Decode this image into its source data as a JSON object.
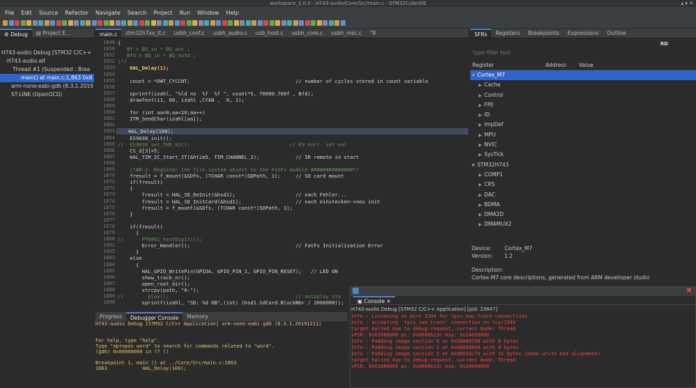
{
  "window": {
    "title": "workspace_1.0.0 - H743-audio/Core/Src/main.c - STM32CubeIDE"
  },
  "menu": [
    "File",
    "Edit",
    "Source",
    "Refactor",
    "Navigate",
    "Search",
    "Project",
    "Run",
    "Window",
    "Help"
  ],
  "left_tabs": [
    "Debug",
    "Project E..."
  ],
  "debug_tree": [
    "H743-audio Debug [STM32 C/C++",
    "H743-audio.elf",
    "Thread #1 (Suspended : Brea",
    "main() at main.c:1,863 0x8",
    "arm-none-eabi-gdb (8.3.1.2019",
    "ST-LINK (OpenOCD)"
  ],
  "editor_tabs": [
    "main.c",
    "stm32h7xx_it.c",
    "usbh_conf.c",
    "usbh_audio.c",
    "usb_host.c",
    "usbh_core.c",
    "usbh_msc.c",
    "\"8"
  ],
  "code": [
    {
      "n": "1849",
      "t": "{"
    },
    {
      "n": "1850",
      "t": "   Bf = BQ_in * BQ_out ;",
      "c": "cm"
    },
    {
      "n": "1851",
      "t": "   Bfd = BQ_in * BQ_outd ;",
      "c": "cm"
    },
    {
      "n": "1852",
      "t": "}*/",
      "c": "cm"
    },
    {
      "n": "1853",
      "t": "    HAL_Delay(1);",
      "c": "fn"
    },
    {
      "n": "1854",
      "t": ""
    },
    {
      "n": "1855",
      "t": "    count = *DWT_CYCCNT;                                   // number of cycles stored in count variable"
    },
    {
      "n": "1856",
      "t": ""
    },
    {
      "n": "1857",
      "t": "    sprintf(izahl, \"%ld ns  %f  %f \", count*5, 70000.700f , Bfd);"
    },
    {
      "n": "1858",
      "t": "    drawText(11, 60, izahl ,CYAN ,  0, 1);"
    },
    {
      "n": "1859",
      "t": ""
    },
    {
      "n": "1860",
      "t": "    for (int aa=0;aa<10;aa++)"
    },
    {
      "n": "1861",
      "t": "    ITM_SendChar(izahl[aa]);"
    },
    {
      "n": "1862",
      "t": ""
    },
    {
      "n": "1863",
      "t": "    HAL_Delay(100);",
      "hl": true
    },
    {
      "n": "1864",
      "t": "    ES9038_init();"
    },
    {
      "n": "1865",
      "t": "//  ES9038_set_THD_K3();                                 // K3 korr. set val",
      "c": "cm"
    },
    {
      "n": "1866",
      "t": "    CS_d[3]=5;"
    },
    {
      "n": "1867",
      "t": "    HAL_TIM_IC_Start_IT(&htim5, TIM_CHANNEL_2);            // IR remote in start"
    },
    {
      "n": "1868",
      "t": ""
    },
    {
      "n": "1869",
      "t": "    /*##-2- Register the file system object to the FatFs module ##############*/",
      "c": "cm"
    },
    {
      "n": "1870",
      "t": "    fresult = f_mount(&SDfs, (TCHAR const*)SDPath, 1);     // SD card mount"
    },
    {
      "n": "1871",
      "t": "    if(fresult)"
    },
    {
      "n": "1872",
      "t": "    {"
    },
    {
      "n": "1873",
      "t": "        fresult = HAL_SD_DeInit(&hsd1);                    // nach Fehler..."
    },
    {
      "n": "1874",
      "t": "        fresult = HAL_SD_InitCard(&hsd1);                  // nach einstecken->neu init"
    },
    {
      "n": "1875",
      "t": "        fresult = f_mount(&SDfs, (TCHAR const*)SDPath, 1);"
    },
    {
      "n": "1876",
      "t": "    }"
    },
    {
      "n": "1877",
      "t": ""
    },
    {
      "n": "1878",
      "t": "    if(fresult)"
    },
    {
      "n": "1879",
      "t": "      {"
    },
    {
      "n": "1880",
      "t": "//      PT6961_testDigits();",
      "c": "cm"
    },
    {
      "n": "1881",
      "t": "        Error_Handler();                                   // FatFs Initialization Error"
    },
    {
      "n": "1882",
      "t": "      }"
    },
    {
      "n": "1883",
      "t": "    else"
    },
    {
      "n": "1884",
      "t": "      {"
    },
    {
      "n": "1885",
      "t": "        HAL_GPIO_WritePin(GPIOA, GPIO_PIN_1, GPIO_PIN_RESET);   // LED ON"
    },
    {
      "n": "1886",
      "t": "        show_track_nr();"
    },
    {
      "n": "1887",
      "t": "        open_root_dir();"
    },
    {
      "n": "1888",
      "t": "        strcpy(path, \"0:\");"
    },
    {
      "n": "1889",
      "t": "//        play();                                          // autoplay sta",
      "c": "cm"
    },
    {
      "n": "1890",
      "t": "        sprintf(izahl, \"SD: %d GB\",(int) (hsd1.SdCard.BlockNbr / 2000000));"
    }
  ],
  "right_tabs": [
    "SFRs",
    "Registers",
    "Breakpoints",
    "Expressions",
    "Outline"
  ],
  "sfr": {
    "filter_placeholder": "type filter text",
    "rd_label": "RD",
    "col_register": "Register",
    "col_address": "Address",
    "col_value": "Value",
    "tree": [
      {
        "l": "Cortex_M7",
        "lvl": 0,
        "open": true,
        "sel": true
      },
      {
        "l": "Cache",
        "lvl": 1
      },
      {
        "l": "Control",
        "lvl": 1
      },
      {
        "l": "FPE",
        "lvl": 1
      },
      {
        "l": "ID",
        "lvl": 1
      },
      {
        "l": "ImpDef",
        "lvl": 1
      },
      {
        "l": "MPU",
        "lvl": 1
      },
      {
        "l": "NVIC",
        "lvl": 1
      },
      {
        "l": "SysTick",
        "lvl": 1
      },
      {
        "l": "STM32H743",
        "lvl": 0,
        "open": true
      },
      {
        "l": "COMP1",
        "lvl": 1
      },
      {
        "l": "CRS",
        "lvl": 1
      },
      {
        "l": "DAC",
        "lvl": 1
      },
      {
        "l": "BDMA",
        "lvl": 1
      },
      {
        "l": "DMA2D",
        "lvl": 1
      },
      {
        "l": "DMAMUX2",
        "lvl": 1
      }
    ],
    "device_label": "Device:",
    "device_value": "Cortex_M7",
    "version_label": "Version:",
    "version_value": "1.2",
    "description_label": "Description:",
    "description_value": "Cortex-M7 core descriptions, generated from ARM develloper studio"
  },
  "bottom_tabs": [
    "Progress",
    "Debugger Console",
    "Memory"
  ],
  "console1": "H743-audio Debug [STM32 C/C++ Application] arm-none-eabi-gdb (8.3.1.20191211)\n\n\nFor help, type \"help\".\nType \"apropos word\" to search for commands related to \"word\".\n(gdb) 0x00000000 in ?? ()\n\nBreakpoint 1, main () at ../Core/Src/main.c:1863\n1863            HAL_Delay(100);",
  "console2": {
    "tab": "Console",
    "header": "H743-audio Debug [STM32 C/C++ Application] [pid: 23647]",
    "lines": [
      "Info : Listening on port 3344 for tpiu_swo_trace connections",
      "Info : accepting 'tpiu_swo_trace' connection on tcp/3344",
      "target halted due to debug-request, current mode: Thread",
      "xPSR: 0x01000000 pc: 0x0800b23c msp: 0x24080000",
      "Info : Padding image section 0 at 0x08000298 with 8 bytes",
      "Info : Padding image section 1 at 0x08020644 with 4 bytes",
      "Info : Padding image section 2 at 0x08024cf4 with 12 bytes (bank write end alignment)",
      "target halted due to debug-request, current mode: Thread",
      "xPSR: 0x01000000 pc: 0x0800b23c msp: 0x24080000"
    ]
  }
}
